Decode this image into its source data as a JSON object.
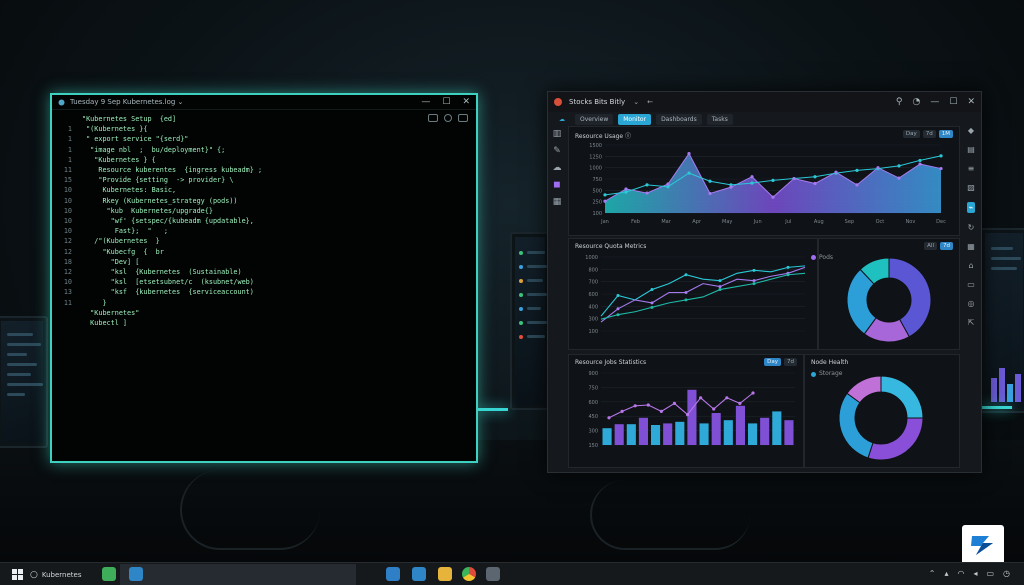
{
  "terminal": {
    "title": "Tuesday 9 Sep Kubernetes.log  ⌄",
    "lines": [
      {
        "num": "",
        "text": "\"Kubernetes Setup  {ed]"
      },
      {
        "num": "1",
        "text": " \"(Kubernetes }{"
      },
      {
        "num": "1",
        "text": " \" export service \"{serd}\""
      },
      {
        "num": "1",
        "text": "  \"image nbl  ;  bu/deployment}\" {;"
      },
      {
        "num": "1",
        "text": "   \"Kubernetes } {"
      },
      {
        "num": "11",
        "text": "    Resource kuberentes  {ingress kubeadm} ;"
      },
      {
        "num": "15",
        "text": "    \"Provide {setting  -> provider} \\"
      },
      {
        "num": "10",
        "text": "     Kubernetes: Basic,"
      },
      {
        "num": "10",
        "text": "     Rkey (Kubernetes_strategy (pods))"
      },
      {
        "num": "10",
        "text": "      \"kub  Kubernetes/upgrade{}"
      },
      {
        "num": "10",
        "text": "       \"wf' {setspec/{kubeadm {updatable},"
      },
      {
        "num": "10",
        "text": "        Fast};  \"   ;"
      },
      {
        "num": "12",
        "text": "   /\"(Kubernetes  }"
      },
      {
        "num": "12",
        "text": "     \"Kubecfg  {  br"
      },
      {
        "num": "18",
        "text": "       \"Dev] ["
      },
      {
        "num": "12",
        "text": "       \"ksl  {Kubernetes  (Sustainable)"
      },
      {
        "num": "10",
        "text": "       \"ksl  [etsetsubnet/c  (ksubnet/web)"
      },
      {
        "num": "13",
        "text": "       \"ksf  {kubernetes  {serviceaccount)"
      },
      {
        "num": "11",
        "text": "     }"
      },
      {
        "num": "",
        "text": "  \"Kubernetes\""
      },
      {
        "num": "",
        "text": "  Kubectl ]"
      }
    ]
  },
  "dashboard": {
    "title": "Stocks Bits Bitly",
    "tabs": [
      "Overview",
      "Monitor",
      "Dashboards",
      "Tasks"
    ],
    "active_tab": 1,
    "panel1": {
      "title": "Resource Usage  Ⓘ",
      "buttons": [
        "Day",
        "7d",
        "1M"
      ]
    },
    "panel2": {
      "title": "Resource Quota Metrics",
      "buttons": [
        "All",
        "7d"
      ],
      "legend": "Pods"
    },
    "panel3": {
      "title": "Resource Jobs  Statistics",
      "buttons": [
        "Day",
        "7d"
      ],
      "legend": "Storage"
    },
    "pie1_title": "",
    "pie2_title": "Node Health"
  },
  "chart_data": [
    {
      "type": "area",
      "title": "Resource Usage",
      "yticks": [
        "1500",
        "1250",
        "1000",
        "750",
        "500",
        "250",
        "100"
      ],
      "categories": [
        "Jan",
        "Feb",
        "Mar",
        "Apr",
        "May",
        "Jun",
        "Jul",
        "Aug",
        "Sep",
        "Oct",
        "Nov",
        "Dec"
      ],
      "ylim": [
        0,
        1500
      ],
      "series": [
        {
          "name": "",
          "values": [
            260,
            530,
            440,
            640,
            1310,
            430,
            570,
            800,
            350,
            760,
            650,
            900,
            620,
            1000,
            770,
            1080,
            980
          ]
        },
        {
          "name": "",
          "values": [
            400,
            460,
            620,
            580,
            880,
            700,
            620,
            660,
            720,
            760,
            800,
            880,
            940,
            980,
            1040,
            1160,
            1260
          ]
        }
      ]
    },
    {
      "type": "line",
      "title": "Resource Quota Metrics",
      "yticks": [
        "1000",
        "800",
        "700",
        "600",
        "400",
        "300",
        "100"
      ],
      "ylim": [
        0,
        1000
      ],
      "series": [
        {
          "name": "",
          "values": [
            200,
            480,
            420,
            560,
            640,
            760,
            700,
            680,
            780,
            820,
            800,
            860,
            880
          ]
        },
        {
          "name": "Pods",
          "values": [
            120,
            300,
            420,
            380,
            520,
            520,
            640,
            600,
            700,
            680,
            740,
            780,
            860
          ]
        },
        {
          "name": "",
          "values": [
            160,
            220,
            260,
            320,
            380,
            420,
            460,
            560,
            600,
            640,
            700,
            760,
            780
          ]
        }
      ]
    },
    {
      "type": "pie",
      "title": "",
      "slices": [
        {
          "label": "",
          "value": 42,
          "color": "#5b56d4"
        },
        {
          "label": "",
          "value": 18,
          "color": "#a867d8"
        },
        {
          "label": "",
          "value": 28,
          "color": "#2c9ed8"
        },
        {
          "label": "",
          "value": 12,
          "color": "#1fc0c0"
        }
      ]
    },
    {
      "type": "bar",
      "title": "Resource Jobs Statistics",
      "yticks": [
        "900",
        "750",
        "600",
        "450",
        "300",
        "150"
      ],
      "ylim": [
        0,
        900
      ],
      "bars": [
        210,
        260,
        260,
        340,
        250,
        270,
        290,
        690,
        270,
        400,
        310,
        490,
        270,
        340,
        420,
        310
      ],
      "line": [
        340,
        420,
        490,
        500,
        420,
        520,
        380,
        590,
        450,
        590,
        520,
        650
      ]
    },
    {
      "type": "pie",
      "title": "Node Health",
      "slices": [
        {
          "label": "",
          "value": 25,
          "color": "#37b8e0"
        },
        {
          "label": "",
          "value": 30,
          "color": "#8a4fd8"
        },
        {
          "label": "",
          "value": 30,
          "color": "#2c9ed8"
        },
        {
          "label": "",
          "value": 15,
          "color": "#c071d8"
        }
      ]
    }
  ],
  "taskbar": {
    "search_text": "Kubernetes",
    "tray_icons": [
      "chevron-up",
      "network",
      "wifi",
      "volume",
      "battery",
      "clock"
    ]
  },
  "colors": {
    "terminal_border": "#3fd1bf",
    "terminal_text": "#9cf0bb",
    "accent_blue": "#2aa6d4",
    "accent_purple": "#a06cf0"
  }
}
